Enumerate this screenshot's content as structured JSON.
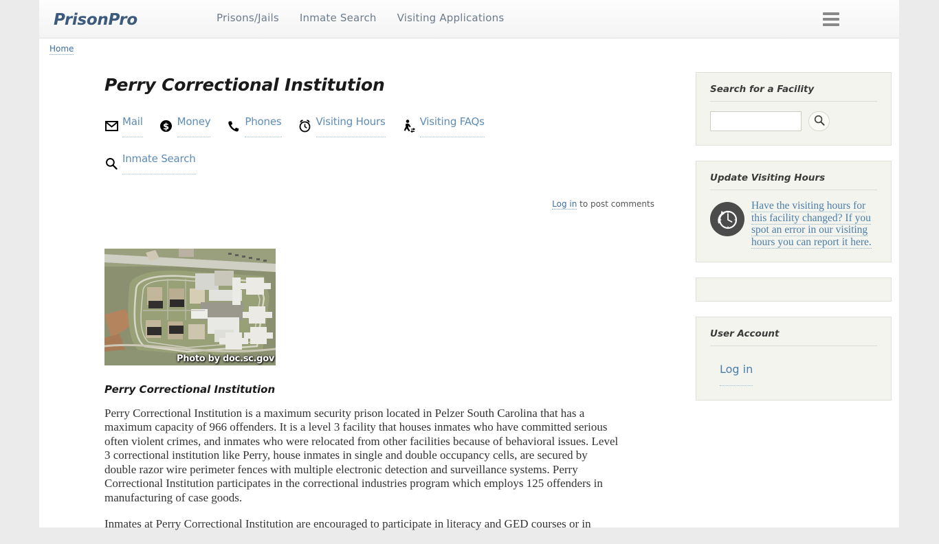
{
  "header": {
    "logo": "PrisonPro",
    "nav": [
      {
        "label": "Prisons/Jails"
      },
      {
        "label": "Inmate Search"
      },
      {
        "label": "Visiting Applications"
      }
    ],
    "menu_icon": "hamburger-menu-icon"
  },
  "breadcrumb": {
    "home": "Home"
  },
  "main": {
    "page_title": "Perry Correctional Institution",
    "quicklinks": [
      {
        "label": "Mail",
        "icon": "envelope-icon"
      },
      {
        "label": "Money",
        "icon": "dollar-coin-icon"
      },
      {
        "label": "Phones",
        "icon": "phone-icon"
      },
      {
        "label": "Visiting Hours",
        "icon": "alarm-clock-icon"
      },
      {
        "label": "Visiting FAQs",
        "icon": "visitor-walking-icon"
      },
      {
        "label": "Inmate Search",
        "icon": "magnifier-icon"
      }
    ],
    "comments": {
      "login_label": "Log in",
      "suffix": " to post comments"
    },
    "photo": {
      "credit": "Photo by doc.sc.gov",
      "alt": "aerial-view-of-prison-facility"
    },
    "article": {
      "heading": "Perry Correctional Institution",
      "paragraphs": [
        "Perry Correctional Institution is a maximum security prison located in Pelzer South Carolina that has a maximum capacity of 966 offenders.  It is a level 3 facility that houses inmates who have committed serious often violent crimes, and inmates who were relocated from other facilities because of behavioral issues.  Level 3 correctional institution like Perry, house inmates in single and double occupancy cells, are secured by double razor wire perimeter fences with multiple electronic detection and surveillance systems.  Perry Correctional Institution participates in the correctional industries program which employs 125 offenders in manufacturing of case goods.",
        "Inmates at Perry Correctional Institution are encouraged to participate in literacy and GED courses or in"
      ]
    }
  },
  "sidebar": {
    "search_widget": {
      "title": "Search for a Facility",
      "input_value": "",
      "input_placeholder": "",
      "button_icon": "search-icon"
    },
    "update_widget": {
      "title": "Update Visiting Hours",
      "icon": "clock-refresh-icon",
      "link_text": "Have the visiting hours for this facility changed?  If you spot an error in our visiting hours you can report it here."
    },
    "empty_widget": {
      "content": ""
    },
    "account_widget": {
      "title": "User Account",
      "login_label": "Log in"
    }
  },
  "colors": {
    "logo": "#3c5a7c",
    "link": "#5e8cb5",
    "nav": "#6b7b8c",
    "widget_bg": "#f4f4ef",
    "page_bg": "#ebebeb"
  }
}
